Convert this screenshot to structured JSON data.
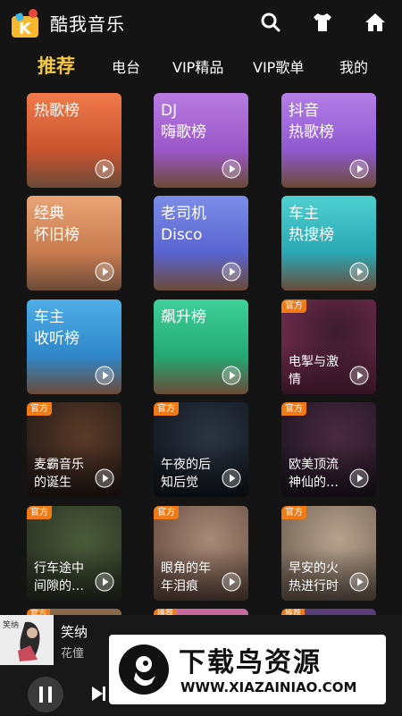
{
  "app": {
    "title": "酷我音乐"
  },
  "tabs": [
    {
      "label": "推荐",
      "active": true
    },
    {
      "label": "电台"
    },
    {
      "label": "VIP精品"
    },
    {
      "label": "VIP歌单"
    },
    {
      "label": "我的"
    }
  ],
  "header_icons": [
    "search-icon",
    "tshirt-icon",
    "home-icon"
  ],
  "cards": [
    {
      "l1": "热歌榜",
      "l2": "",
      "kind": "chart",
      "colors": [
        "#f07a4a",
        "#c9542f"
      ]
    },
    {
      "l1": "DJ",
      "l2": "嗨歌榜",
      "kind": "chart",
      "colors": [
        "#b77be0",
        "#9a58c8"
      ]
    },
    {
      "l1": "抖音",
      "l2": "热歌榜",
      "kind": "chart",
      "colors": [
        "#b47ee6",
        "#8f5ad0"
      ]
    },
    {
      "l1": "经典",
      "l2": "怀旧榜",
      "kind": "chart",
      "colors": [
        "#e9a474",
        "#c77b4f"
      ]
    },
    {
      "l1": "老司机",
      "l2": "Disco",
      "kind": "chart",
      "colors": [
        "#7b8de8",
        "#5a64cf"
      ]
    },
    {
      "l1": "车主",
      "l2": "热搜榜",
      "kind": "chart",
      "colors": [
        "#4fd0d0",
        "#2aa8b3"
      ]
    },
    {
      "l1": "车主",
      "l2": "收听榜",
      "kind": "chart",
      "colors": [
        "#4faee8",
        "#2f87c8"
      ]
    },
    {
      "l1": "飙升榜",
      "l2": "",
      "kind": "chart",
      "colors": [
        "#3fd09a",
        "#24a874"
      ]
    },
    {
      "badge": "官方",
      "l1": "电掣与激",
      "l2": "情",
      "kind": "photo",
      "colors": [
        "#3b1c2e",
        "#6d2a4a"
      ]
    },
    {
      "badge": "官方",
      "l1": "麦霸音乐",
      "l2": "的诞生",
      "kind": "photo",
      "colors": [
        "#5a3a28",
        "#2a1e1a"
      ]
    },
    {
      "badge": "官方",
      "l1": "午夜的后",
      "l2": "知后觉",
      "kind": "photo",
      "colors": [
        "#2b3442",
        "#141a22"
      ]
    },
    {
      "badge": "官方",
      "l1": "欧美顶流",
      "l2": "神仙的…",
      "kind": "photo",
      "colors": [
        "#4a2a3e",
        "#231826"
      ]
    },
    {
      "badge": "官方",
      "l1": "行车途中",
      "l2": "间隙的…",
      "kind": "photo",
      "colors": [
        "#4b5a3a",
        "#2d3626"
      ]
    },
    {
      "badge": "官方",
      "l1": "眼角的年",
      "l2": "年泪痕",
      "kind": "photo",
      "colors": [
        "#a88a78",
        "#6e5448"
      ]
    },
    {
      "badge": "官方",
      "l1": "早安的火",
      "l2": "热进行时",
      "kind": "photo",
      "colors": [
        "#b7a28e",
        "#7a6a5c"
      ]
    }
  ],
  "peek_badges": [
    "官方",
    "推荐",
    "推荐"
  ],
  "player": {
    "song": "笑纳",
    "artist": "花僮",
    "cover_text": "笑纳"
  },
  "watermark": {
    "brand": "下载鸟资源",
    "url": "WWW.XIAZAINIAO.COM"
  }
}
